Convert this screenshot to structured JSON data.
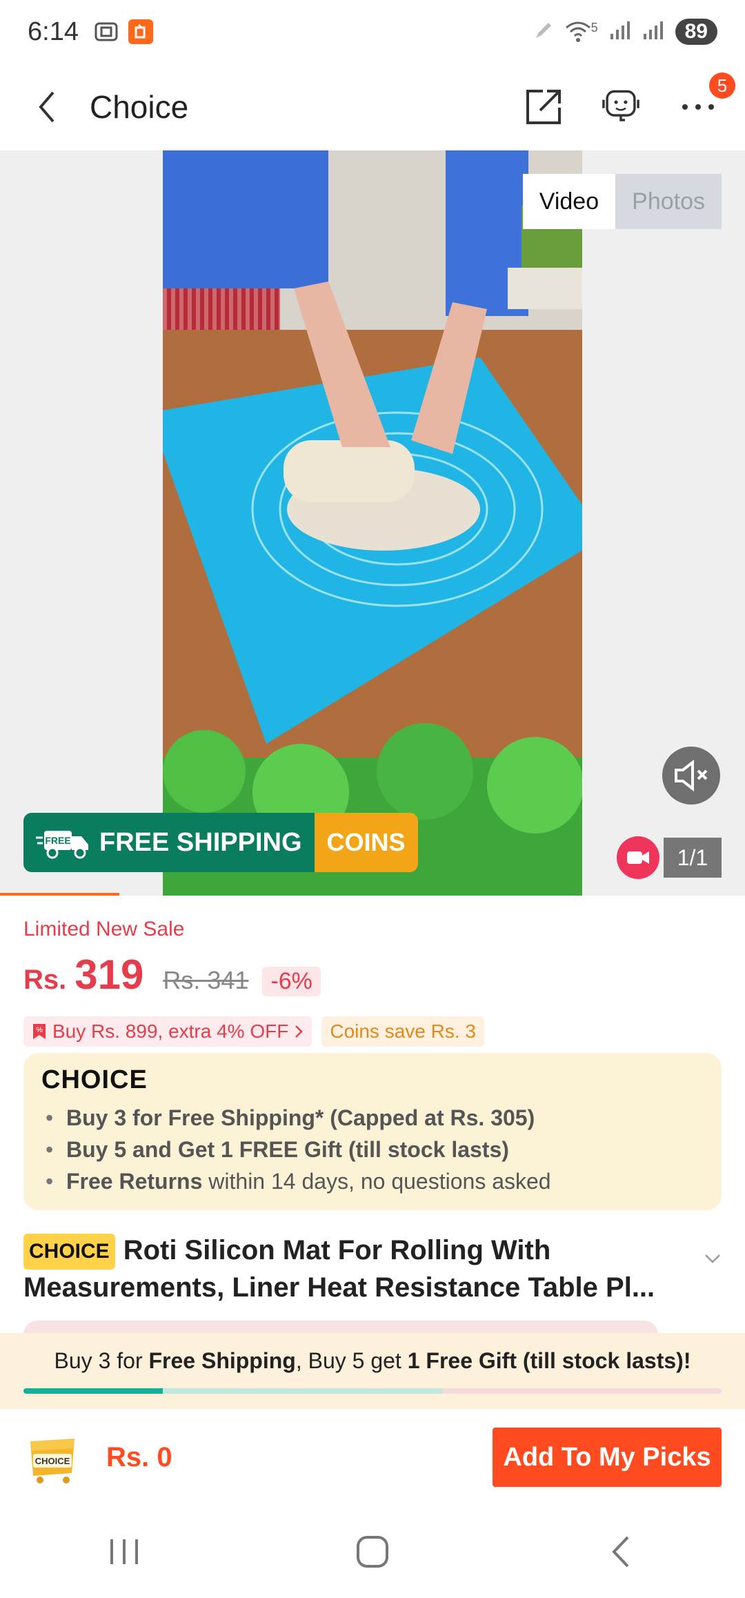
{
  "status_bar": {
    "time": "6:14",
    "wifi_label": "5",
    "battery": "89"
  },
  "header": {
    "title": "Choice",
    "cart_badge": "5"
  },
  "media": {
    "tabs": [
      {
        "label": "Video",
        "active": true
      },
      {
        "label": "Photos",
        "active": false
      }
    ],
    "promo": {
      "free_badge": "FREE",
      "free_shipping": "FREE SHIPPING",
      "coins": "COINS"
    },
    "counter": "1/1",
    "video_progress": 0.16
  },
  "product": {
    "sale_tag": "Limited New Sale",
    "currency": "Rs.",
    "price": "319",
    "old_price": "Rs. 341",
    "discount": "-6%",
    "offers": {
      "extra_off": "Buy Rs. 899, extra 4% OFF",
      "coins_save": "Coins save Rs. 3"
    },
    "choice_box": {
      "logo": "CHOICE",
      "items": [
        {
          "bold": "Buy 3 for  Free Shipping* (Capped at Rs. 305)",
          "rest": ""
        },
        {
          "bold": "Buy 5 and Get 1 FREE Gift (till stock lasts)",
          "rest": ""
        },
        {
          "bold": "Free Returns",
          "rest": " within 14 days, no questions asked"
        }
      ]
    },
    "title_badge": "CHOICE",
    "title": "Roti Silicon Mat For Rolling With Measurements, Liner Heat Resistance Table Pl..."
  },
  "bundle": {
    "part1": "Buy 3 for ",
    "bold1": "Free Shipping",
    "part2": ", Buy 5 get ",
    "bold2": "1 Free Gift (till stock lasts)!",
    "progress": 0.6
  },
  "bottom_bar": {
    "cart_label": "CHOICE",
    "total": "Rs. 0",
    "add_button": "Add To My Picks"
  },
  "colors": {
    "accent": "#ff4b1f",
    "sale_red": "#e63d4c",
    "free_shipping_green": "#0a7d5e",
    "coins_orange": "#f2a516",
    "choice_bg": "#fcf2d6"
  }
}
